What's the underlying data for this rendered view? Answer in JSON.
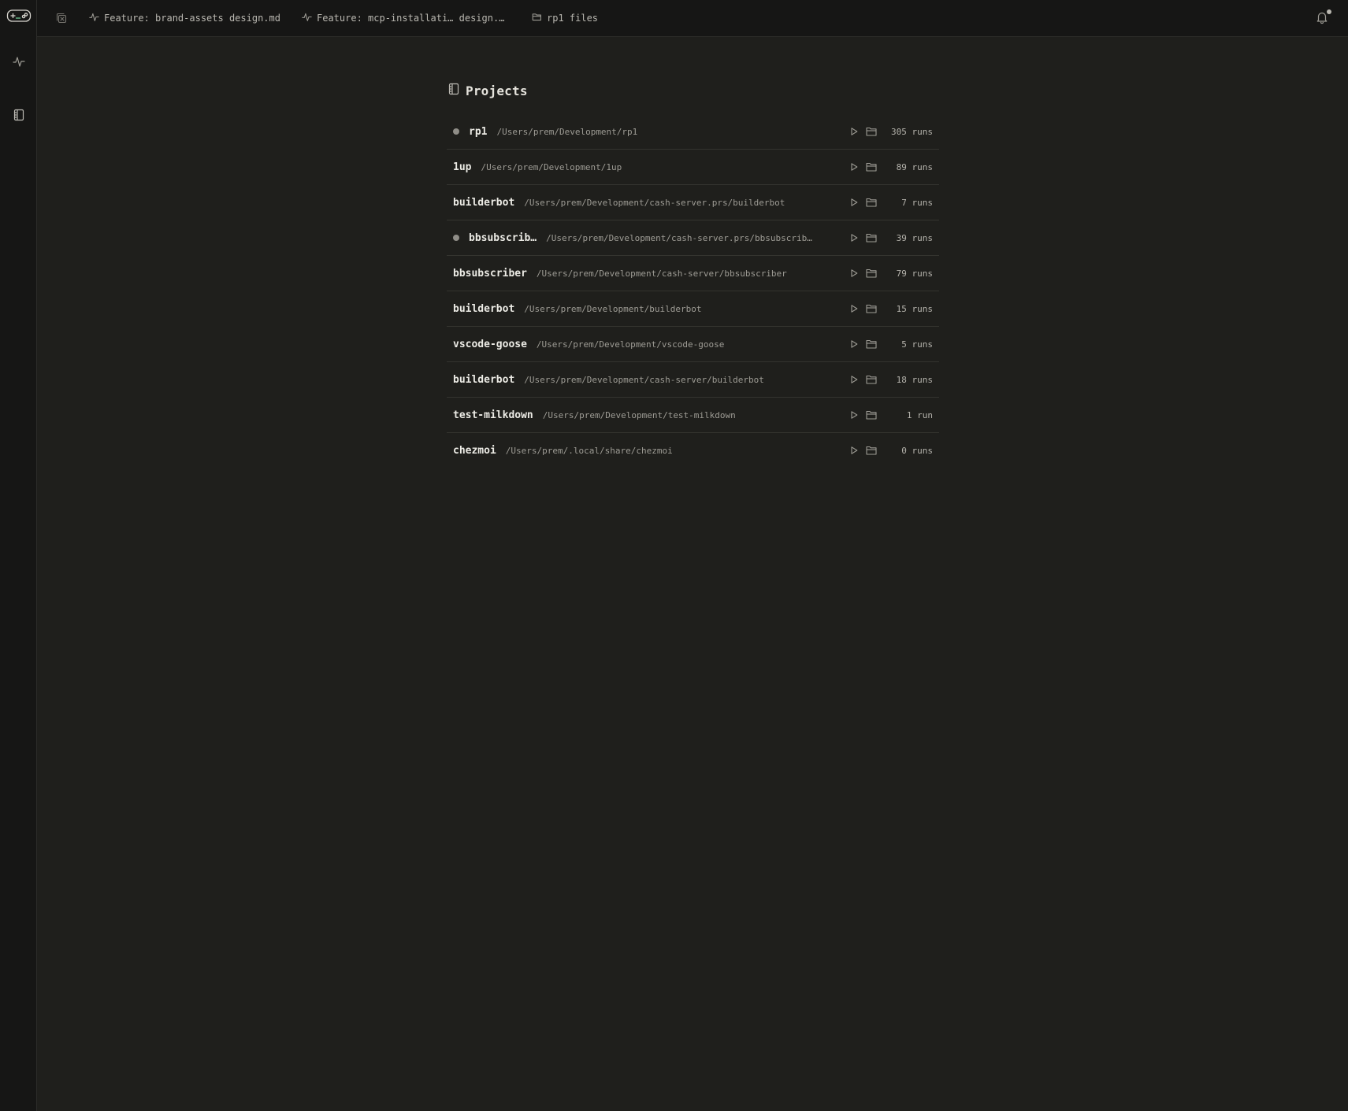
{
  "rail": {
    "items": [
      {
        "name": "app-logo",
        "icon": "gamepad-icon"
      },
      {
        "name": "activity",
        "icon": "activity-icon"
      },
      {
        "name": "projects",
        "icon": "notebook-icon"
      }
    ]
  },
  "tabs": [
    {
      "label": "Feature: brand-assets design.md",
      "icon": "activity-icon"
    },
    {
      "label": "Feature: mcp-installati… design.…",
      "icon": "activity-icon"
    },
    {
      "label": "rp1 files",
      "icon": "folder-icon"
    }
  ],
  "header": {
    "title": "Projects",
    "icon": "notebook-icon"
  },
  "projects": [
    {
      "name": "rp1",
      "path": "/Users/prem/Development/rp1",
      "runs": "305 runs",
      "active": true
    },
    {
      "name": "1up",
      "path": "/Users/prem/Development/1up",
      "runs": "89 runs",
      "active": false
    },
    {
      "name": "builderbot",
      "path": "/Users/prem/Development/cash-server.prs/builderbot",
      "runs": "7 runs",
      "active": false
    },
    {
      "name": "bbsubscrib…",
      "path": "/Users/prem/Development/cash-server.prs/bbsubscrib…",
      "runs": "39 runs",
      "active": true
    },
    {
      "name": "bbsubscriber",
      "path": "/Users/prem/Development/cash-server/bbsubscriber",
      "runs": "79 runs",
      "active": false
    },
    {
      "name": "builderbot",
      "path": "/Users/prem/Development/builderbot",
      "runs": "15 runs",
      "active": false
    },
    {
      "name": "vscode-goose",
      "path": "/Users/prem/Development/vscode-goose",
      "runs": "5 runs",
      "active": false
    },
    {
      "name": "builderbot",
      "path": "/Users/prem/Development/cash-server/builderbot",
      "runs": "18 runs",
      "active": false
    },
    {
      "name": "test-milkdown",
      "path": "/Users/prem/Development/test-milkdown",
      "runs": "1 run",
      "active": false
    },
    {
      "name": "chezmoi",
      "path": "/Users/prem/.local/share/chezmoi",
      "runs": "0 runs",
      "active": false
    }
  ],
  "colors": {
    "background": "#1f1f1c",
    "chrome": "#161615",
    "accent_logo": "#6fcf97",
    "status_dot": "#8f8d87"
  }
}
